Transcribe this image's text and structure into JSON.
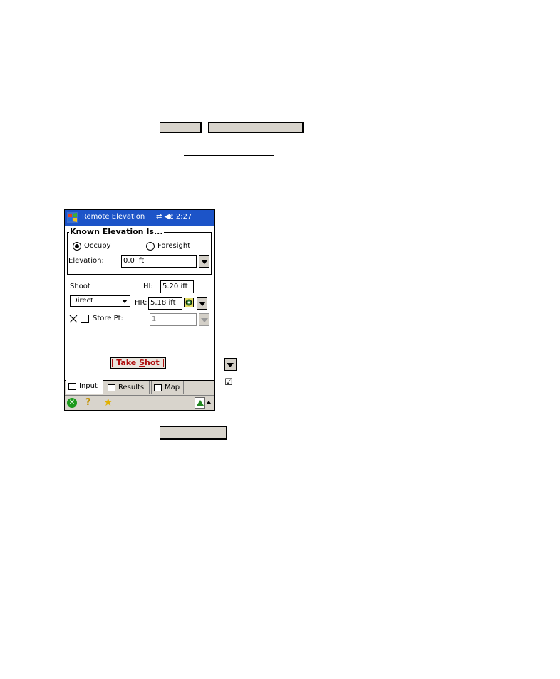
{
  "titlebar": {
    "title": "Remote Elevation",
    "status": "⇄ ◀ε 2:27"
  },
  "known_elevation": {
    "legend": "Known Elevation Is...",
    "options": [
      "Occupy",
      "Foresight"
    ],
    "selected": "Occupy",
    "elevation_label": "Elevation:",
    "elevation_value": "0.0 ift"
  },
  "shoot": {
    "label": "Shoot",
    "mode": "Direct",
    "hi_label": "HI:",
    "hi_value": "5.20 ift",
    "hr_label": "HR:",
    "hr_value": "5.18 ift",
    "store_label": "Store Pt:",
    "store_value": "1",
    "store_checked": false
  },
  "take_shot": "Take Shot",
  "tabs": [
    {
      "label": "Input",
      "active": true
    },
    {
      "label": "Results",
      "active": false
    },
    {
      "label": "Map",
      "active": false
    }
  ],
  "colors": {
    "titlebar": "#1c54c8",
    "take_shot_text": "#b01010",
    "chrome": "#d8d4cc"
  },
  "icons": [
    "windows-start-icon",
    "ok-icon",
    "help-icon",
    "favorites-icon",
    "sip-icon",
    "dropdown-arrow-icon",
    "checkbox-checked-icon"
  ],
  "legend_checkbox_glyph": "☑"
}
